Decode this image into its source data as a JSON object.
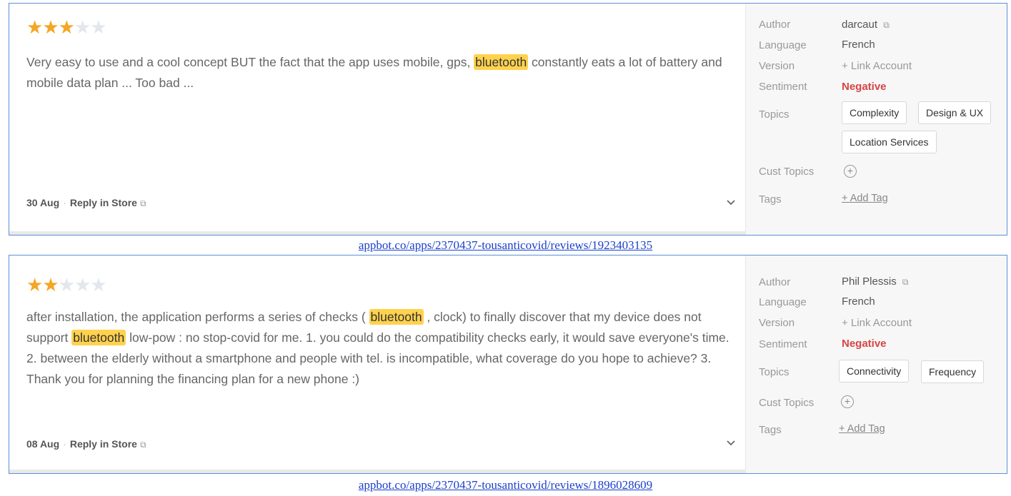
{
  "labels": {
    "author": "Author",
    "language": "Language",
    "version": "Version",
    "sentiment": "Sentiment",
    "topics": "Topics",
    "cust_topics": "Cust Topics",
    "tags": "Tags",
    "reply": "Reply in Store",
    "link_account": "+ Link Account",
    "add_tag": "+ Add Tag",
    "add_topic": "+",
    "ext_icon": "⧉"
  },
  "reviews": [
    {
      "stars": 3,
      "max_stars": 5,
      "text_1": "Very easy to use and a cool concept BUT the fact that the app uses mobile, gps, ",
      "highlight_1": "bluetooth",
      "text_2": " constantly eats a lot of battery and mobile data plan ... Too bad ...",
      "date": "30 Aug",
      "author": "darcaut",
      "language": "French",
      "sentiment": "Negative",
      "topics": [
        "Complexity",
        "Design & UX",
        "Location Services"
      ],
      "url": "appbot.co/apps/2370437-tousanticovid/reviews/1923403135"
    },
    {
      "stars": 2,
      "max_stars": 5,
      "text_1": "after installation, the application performs a series of checks ( ",
      "highlight_1": "bluetooth",
      "text_2": " , clock) to finally discover that my device does not support ",
      "highlight_2": "bluetooth",
      "text_3": " low-pow : no stop-covid for me. 1. you could do the compatibility checks early, it would save everyone's time. 2. between the elderly without a smartphone and people with tel. is incompatible, what coverage do you hope to achieve? 3. Thank you for planning the financing plan for a new phone :)",
      "date": "08 Aug",
      "author": "Phil Plessis",
      "language": "French",
      "sentiment": "Negative",
      "topics": [
        "Connectivity",
        "Frequency"
      ],
      "url": "appbot.co/apps/2370437-tousanticovid/reviews/1896028609"
    }
  ],
  "colors": {
    "star_on": "#f5a623",
    "star_off": "#e3e6ea",
    "highlight": "#ffd24d",
    "negative": "#d64545",
    "border": "#5b8fd6",
    "url_link": "#1a3fcc"
  }
}
